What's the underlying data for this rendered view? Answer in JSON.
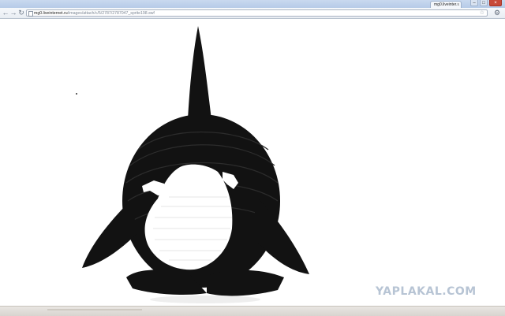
{
  "browser": {
    "tab_title": "mg0.liveinter...",
    "tab_close": "×",
    "window_controls": {
      "minimize": "–",
      "maximize": "□",
      "close": "×"
    },
    "nav": {
      "back": "←",
      "forward": "→",
      "reload": "↻"
    },
    "url_host": "mg0.liveinternet.ru",
    "url_path": "/images/attach/c/5/2787/2787047_sprite198.swf",
    "star": "☆",
    "menu": "⚙"
  },
  "content": {
    "image_subject": "cartoon-orca",
    "watermark": "YAPLAKAL.COM",
    "colors": {
      "page_background": "#ffffff",
      "orca_body": "#111111",
      "orca_belly": "#ffffff",
      "watermark": "#b7c4d4"
    }
  }
}
